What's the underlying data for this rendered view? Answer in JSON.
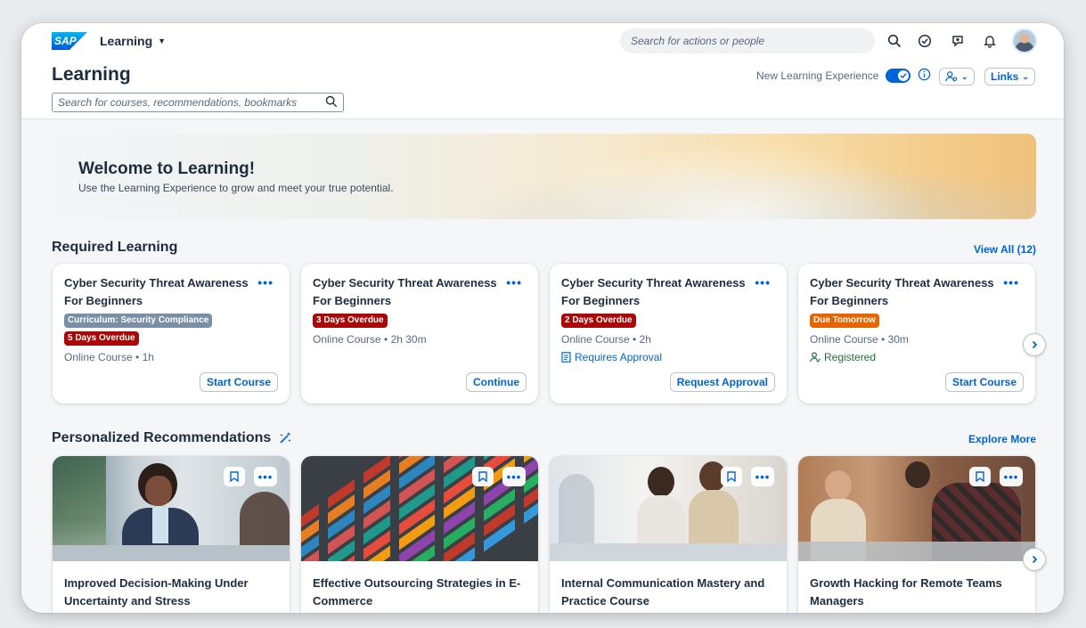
{
  "shell": {
    "logo_text": "SAP",
    "product_label": "Learning",
    "global_search_placeholder": "Search for actions or people",
    "icons": [
      "search-icon",
      "check-circle-icon",
      "ai-assistant-icon",
      "bell-icon"
    ],
    "avatar": "user-avatar"
  },
  "header": {
    "title": "Learning",
    "search_placeholder": "Search for courses, recommendations, bookmarks",
    "new_experience_label": "New Learning Experience",
    "new_experience_enabled": true,
    "links_label": "Links"
  },
  "banner": {
    "title": "Welcome to Learning!",
    "subtitle": "Use the Learning Experience to grow and meet your true potential."
  },
  "required": {
    "title": "Required Learning",
    "view_all": "View All (12)",
    "cards": [
      {
        "title": "Cyber Security Threat Awareness For Beginners",
        "tags": [
          {
            "text": "Curriculum: Security Compliance",
            "color": "#788fa6"
          },
          {
            "text": "5 Days Overdue",
            "color": "#aa0808"
          }
        ],
        "meta": "Online Course • 1h",
        "status": "",
        "action": "Start Course"
      },
      {
        "title": "Cyber Security Threat Awareness For Beginners",
        "tags": [
          {
            "text": "3 Days Overdue",
            "color": "#aa0808"
          }
        ],
        "meta": "Online Course • 2h 30m",
        "status": "",
        "action": "Continue"
      },
      {
        "title": "Cyber Security Threat Awareness For Beginners",
        "tags": [
          {
            "text": "2 Days Overdue",
            "color": "#aa0808"
          }
        ],
        "meta": "Online Course • 2h",
        "status": "Requires Approval",
        "action": "Request Approval"
      },
      {
        "title": "Cyber Security Threat Awareness For Beginners",
        "tags": [
          {
            "text": "Due Tomorrow",
            "color": "#e76500"
          }
        ],
        "meta": "Online Course • 30m",
        "status": "Registered",
        "action": "Start Course"
      }
    ]
  },
  "recommendations": {
    "title": "Personalized Recommendations",
    "explore": "Explore More",
    "cards": [
      {
        "title": "Improved Decision-Making Under Uncertainty and Stress"
      },
      {
        "title": "Effective Outsourcing Strategies in E-Commerce"
      },
      {
        "title": "Internal Communication Mastery and Practice Course"
      },
      {
        "title": "Growth Hacking for Remote Teams Managers"
      }
    ]
  },
  "colors": {
    "accent": "#0064d9",
    "overdue": "#aa0808",
    "due": "#e76500",
    "registered": "#256f3a"
  }
}
